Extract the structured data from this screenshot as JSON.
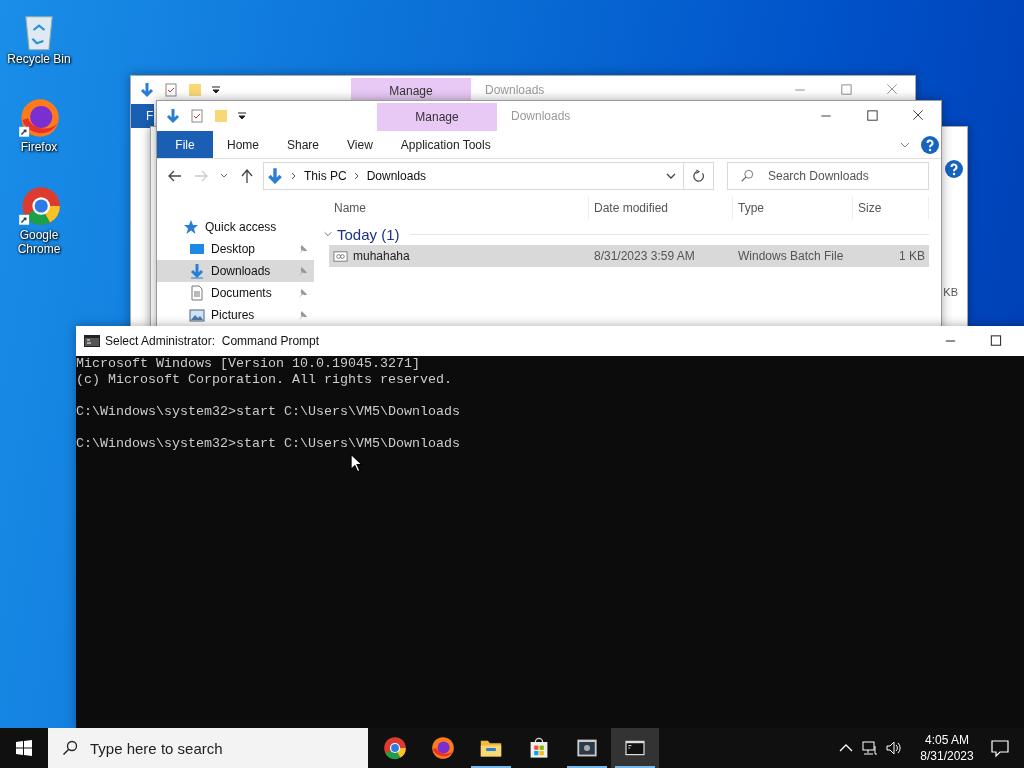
{
  "desktop_icons": [
    {
      "kind": "recycle-bin",
      "label": "Recycle Bin"
    },
    {
      "kind": "firefox",
      "label": "Firefox"
    },
    {
      "kind": "chrome",
      "label": "Google Chrome"
    }
  ],
  "back_window": {
    "context_tab": "Manage",
    "title": "Downloads",
    "ribbon_tab": "F"
  },
  "middle_window": {
    "size_fragment": "KB"
  },
  "explorer": {
    "context_tab": "Manage",
    "title": "Downloads",
    "ribbon_tabs": [
      {
        "label": "File",
        "kind": "file"
      },
      {
        "label": "Home",
        "kind": "tab"
      },
      {
        "label": "Share",
        "kind": "tab"
      },
      {
        "label": "View",
        "kind": "tab"
      },
      {
        "label": "Application Tools",
        "kind": "tab"
      }
    ],
    "address": [
      "This PC",
      "Downloads"
    ],
    "search": {
      "placeholder": "Search Downloads"
    },
    "nav": [
      {
        "label": "Quick access",
        "kind": "star",
        "selected": false,
        "pinned": false
      },
      {
        "label": "Desktop",
        "kind": "desktop",
        "selected": false,
        "pinned": true
      },
      {
        "label": "Downloads",
        "kind": "download",
        "selected": true,
        "pinned": true
      },
      {
        "label": "Documents",
        "kind": "document",
        "selected": false,
        "pinned": true
      },
      {
        "label": "Pictures",
        "kind": "pictures",
        "selected": false,
        "pinned": true
      }
    ],
    "columns": [
      "Name",
      "Date modified",
      "Type",
      "Size"
    ],
    "groups": [
      {
        "label": "Today (1)",
        "expanded": true,
        "rows": [
          {
            "name": "muhahaha",
            "date": "8/31/2023 3:59 AM",
            "type": "Windows Batch File",
            "size": "1 KB",
            "selected": true
          }
        ]
      }
    ]
  },
  "cmd": {
    "title": "Select Administrator:  Command Prompt",
    "blocks": [
      [
        "Microsoft Windows [Version 10.0.19045.3271]",
        "(c) Microsoft Corporation. All rights reserved."
      ],
      [
        "C:\\Windows\\system32>start C:\\Users\\VM5\\Downloads"
      ],
      [
        "C:\\Windows\\system32>start C:\\Users\\VM5\\Downloads"
      ]
    ]
  },
  "taskbar": {
    "search": {
      "placeholder": "Type here to search"
    },
    "apps": [
      {
        "kind": "chrome",
        "running": false,
        "active": false
      },
      {
        "kind": "firefox",
        "running": false,
        "active": false
      },
      {
        "kind": "folder",
        "running": true,
        "active": false
      },
      {
        "kind": "store",
        "running": false,
        "active": false
      },
      {
        "kind": "app",
        "running": true,
        "active": false
      },
      {
        "kind": "terminal",
        "running": true,
        "active": true
      }
    ],
    "time": "4:05 AM",
    "date": "8/31/2023"
  }
}
